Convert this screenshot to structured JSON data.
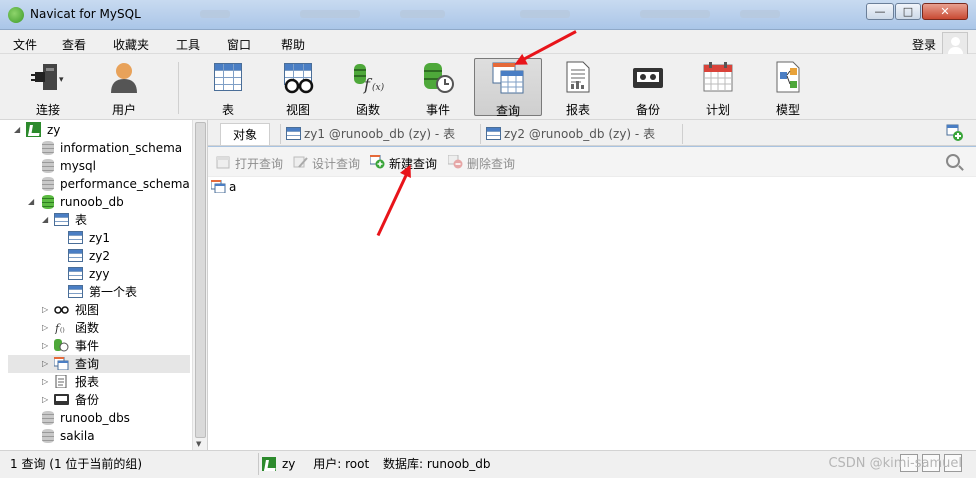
{
  "window": {
    "title": "Navicat for MySQL",
    "controls": {
      "minimize": "—",
      "maximize": "□",
      "close": "✕"
    }
  },
  "menu": {
    "items": [
      "文件",
      "查看",
      "收藏夹",
      "工具",
      "窗口",
      "帮助"
    ],
    "login": "登录"
  },
  "toolbar": {
    "buttons": [
      {
        "label": "连接",
        "icon": "connection-plug-icon"
      },
      {
        "label": "用户",
        "icon": "user-icon"
      },
      {
        "label": "表",
        "icon": "table-icon"
      },
      {
        "label": "视图",
        "icon": "view-glasses-icon"
      },
      {
        "label": "函数",
        "icon": "function-icon"
      },
      {
        "label": "事件",
        "icon": "event-clock-icon"
      },
      {
        "label": "查询",
        "icon": "query-icon",
        "active": true
      },
      {
        "label": "报表",
        "icon": "report-icon"
      },
      {
        "label": "备份",
        "icon": "backup-tape-icon"
      },
      {
        "label": "计划",
        "icon": "schedule-calendar-icon"
      },
      {
        "label": "模型",
        "icon": "model-icon"
      }
    ]
  },
  "tree": {
    "connection": "zy",
    "databases": [
      "information_schema",
      "mysql",
      "performance_schema",
      "runoob_db",
      "runoob_dbs",
      "sakila"
    ],
    "open_db": "runoob_db",
    "tables_folder": "表",
    "tables": [
      "zy1",
      "zy2",
      "zyy",
      "第一个表"
    ],
    "folders": [
      "视图",
      "函数",
      "事件",
      "查询",
      "报表",
      "备份"
    ],
    "selected": "查询"
  },
  "tabs": [
    {
      "label": "对象"
    },
    {
      "label": "zy1 @runoob_db (zy) - 表"
    },
    {
      "label": "zy2 @runoob_db (zy) - 表"
    }
  ],
  "object_toolbar": {
    "open": "打开查询",
    "design": "设计查询",
    "new": "新建查询",
    "delete": "删除查询"
  },
  "objects": [
    {
      "name": "a"
    }
  ],
  "status": {
    "left": "1 查询 (1 位于当前的组)",
    "connection": "zy",
    "user": "用户: root",
    "database": "数据库: runoob_db",
    "watermark": "CSDN @kimi-samuel"
  },
  "colors": {
    "accent": "#4a7ec4",
    "annotation_arrow": "#e8141a",
    "titlebar": "#b9d1ea"
  }
}
